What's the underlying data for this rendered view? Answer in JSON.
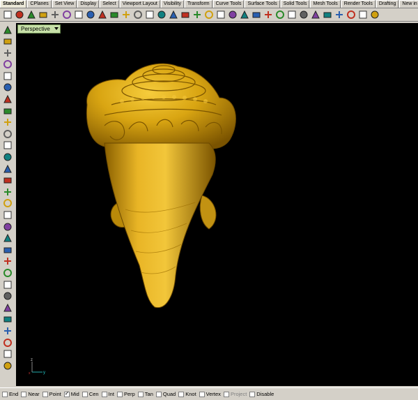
{
  "tabs": [
    "Standard",
    "CPlanes",
    "Set View",
    "Display",
    "Select",
    "Viewport Layout",
    "Visibility",
    "Transform",
    "Curve Tools",
    "Surface Tools",
    "Solid Tools",
    "Mesh Tools",
    "Render Tools",
    "Drafting",
    "New in V"
  ],
  "toolbar_icons": [
    "new-icon",
    "open-icon",
    "save-icon",
    "print-icon",
    "import-icon",
    "cut-icon",
    "copy-icon",
    "paste-icon",
    "undo-icon",
    "pan-icon",
    "rotate-view-icon",
    "zoom-window-icon",
    "zoom-extents-icon",
    "zoom-selected-icon",
    "zoom-dynamic-icon",
    "undo-view-icon",
    "four-viewports-icon",
    "grid-icon",
    "cplane-icon",
    "object-properties-icon",
    "select-icon",
    "layer-icon",
    "light-icon",
    "material-icon",
    "color-wheel-icon",
    "sphere-render-icon",
    "sphere-shade-icon",
    "sphere-wire-icon",
    "render-icon",
    "settings-icon",
    "options-icon",
    "help-icon"
  ],
  "left_icons": [
    "select-arrow-icon",
    "point-icon",
    "polyline-icon",
    "curve-icon",
    "circle-icon",
    "ellipse-icon",
    "polygon-icon",
    "rectangle-icon",
    "arc-icon",
    "fillet-curve-icon",
    "offset-icon",
    "loft-icon",
    "box-icon",
    "sphere-icon",
    "cylinder-icon",
    "extrude-icon",
    "boolean-icon",
    "surface-icon",
    "split-icon",
    "explode-icon",
    "join-icon",
    "trim-icon",
    "dimension-icon",
    "text-icon",
    "transform-icon",
    "array-icon",
    "group-icon",
    "mirror-icon",
    "analyze-icon",
    "more-icon"
  ],
  "viewport": {
    "label": "Perspective",
    "axis_x": "x",
    "axis_y": "y",
    "axis_z": "z"
  },
  "osnaps": [
    {
      "label": "End",
      "checked": false,
      "enabled": true
    },
    {
      "label": "Near",
      "checked": false,
      "enabled": true
    },
    {
      "label": "Point",
      "checked": false,
      "enabled": true
    },
    {
      "label": "Mid",
      "checked": true,
      "enabled": true
    },
    {
      "label": "Cen",
      "checked": false,
      "enabled": true
    },
    {
      "label": "Int",
      "checked": false,
      "enabled": true
    },
    {
      "label": "Perp",
      "checked": false,
      "enabled": true
    },
    {
      "label": "Tan",
      "checked": false,
      "enabled": true
    },
    {
      "label": "Quad",
      "checked": false,
      "enabled": true
    },
    {
      "label": "Knot",
      "checked": false,
      "enabled": true
    },
    {
      "label": "Vertex",
      "checked": false,
      "enabled": true
    },
    {
      "label": "Project",
      "checked": false,
      "enabled": false
    },
    {
      "label": "Disable",
      "checked": false,
      "enabled": true
    }
  ],
  "colors": {
    "model_gold": "#d4a20c",
    "model_dark": "#8a6200",
    "viewport_bg": "#000000",
    "vp_label_bg": "#c7e0a8"
  }
}
